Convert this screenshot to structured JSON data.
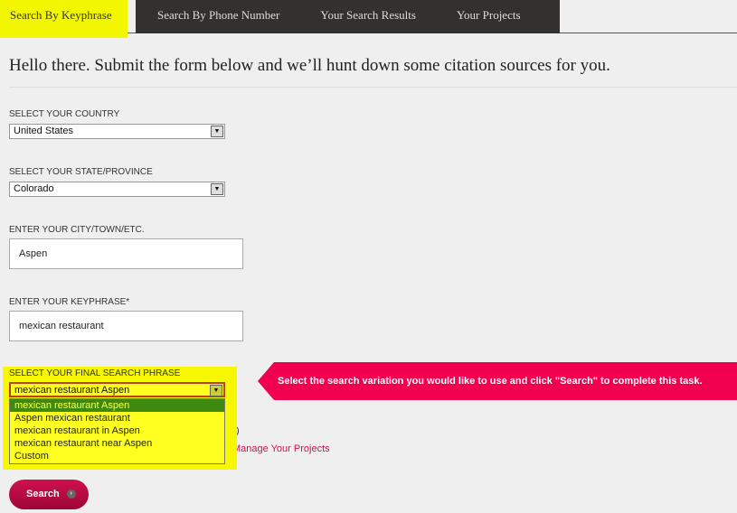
{
  "tabs": [
    "Search By Keyphrase",
    "Search By Phone Number",
    "Your Search Results",
    "Your Projects"
  ],
  "heading": "Hello there. Submit the form below and we’ll hunt down some citation sources for you.",
  "form": {
    "country_label": "SELECT YOUR COUNTRY",
    "country_value": "United States",
    "state_label": "SELECT YOUR STATE/PROVINCE",
    "state_value": "Colorado",
    "city_label": "ENTER YOUR CITY/TOWN/ETC.",
    "city_value": "Aspen",
    "keyphrase_label": "ENTER YOUR KEYPHRASE*",
    "keyphrase_value": "mexican restaurant",
    "final_label": "SELECT YOUR FINAL SEARCH PHRASE",
    "final_value": "mexican restaurant Aspen",
    "final_options": [
      "mexican restaurant Aspen",
      "Aspen mexican restaurant",
      "mexican restaurant in Aspen",
      "mexican restaurant near Aspen",
      "Custom"
    ],
    "hidden_label_fragment": "AL)",
    "manage_link": "Manage Your Projects",
    "search_button": "Search"
  },
  "callout": "Select the search variation you would like to use and click \"Search\" to complete this task.",
  "colors": {
    "highlight": "#f2f700",
    "accent": "#f0004f",
    "tabbar": "#333030",
    "selected_option": "#3e8a10"
  }
}
